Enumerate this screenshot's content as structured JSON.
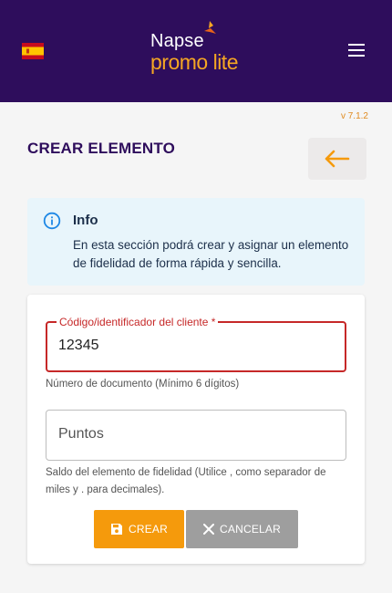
{
  "header": {
    "flag_icon": "spain-flag-icon",
    "logo": {
      "brand": "Napse",
      "product": "promo lite"
    },
    "menu_icon": "hamburger-menu-icon"
  },
  "version": "v 7.1.2",
  "page": {
    "title": "CREAR ELEMENTO",
    "back_icon": "arrow-left-icon"
  },
  "info": {
    "icon": "info-circle-icon",
    "title": "Info",
    "text": "En esta sección podrá crear y asignar un elemento de fidelidad de forma rápida y sencilla."
  },
  "form": {
    "customer_id": {
      "label": "Código/identificador del cliente *",
      "value": "12345",
      "hint": "Número de documento (Mínimo 6 dígitos)"
    },
    "points": {
      "placeholder": "Puntos",
      "value": "",
      "hint": "Saldo del elemento de fidelidad (Utilice , como separador de miles y . para decimales)."
    },
    "create_label": "CREAR",
    "cancel_label": "CANCELAR"
  },
  "colors": {
    "header_bg": "#2e0d5c",
    "accent_orange": "#f59a0c",
    "error_red": "#c62828",
    "info_bg": "#e8f5fb"
  }
}
